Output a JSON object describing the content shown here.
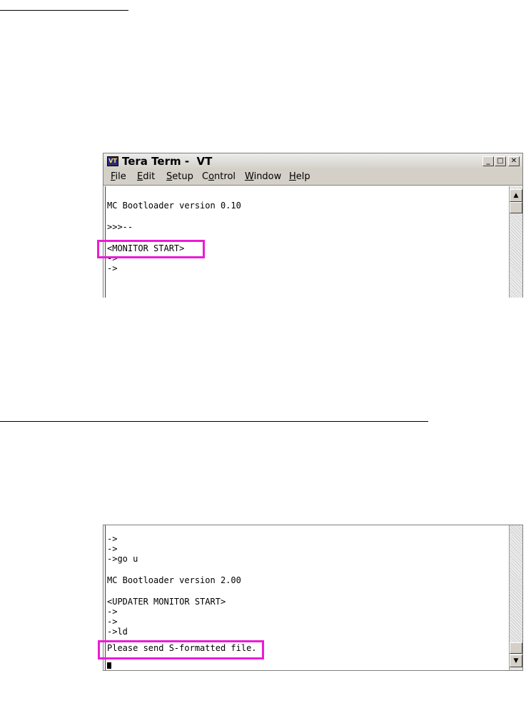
{
  "window1": {
    "title": "Tera Term -  VT",
    "app_icon_text": "VT",
    "controls": {
      "minimize": "_",
      "maximize": "□",
      "close": "✕"
    },
    "menu": [
      "File",
      "Edit",
      "Setup",
      "Control",
      "Window",
      "Help"
    ],
    "menu_mnemonics": [
      "F",
      "E",
      "S",
      "o",
      "W",
      "H"
    ],
    "lines": [
      "MC Bootloader version 0.10",
      ">>>--",
      "<MONITOR START>",
      "->",
      "->"
    ],
    "highlighted_line": "<MONITOR START>"
  },
  "window2": {
    "lines": [
      "->",
      "->",
      "->go u",
      "MC Bootloader version 2.00",
      "<UPDATER MONITOR START>",
      "->",
      "->",
      "->ld",
      "Please send S-formatted file."
    ],
    "highlighted_line": "Please send S-formatted file."
  },
  "colors": {
    "highlight": "#ec1bd6",
    "chrome": "#d4d0c8"
  },
  "icons": [
    "app-icon",
    "minimize-icon",
    "maximize-icon",
    "close-icon",
    "scroll-up-icon",
    "scroll-down-icon"
  ]
}
